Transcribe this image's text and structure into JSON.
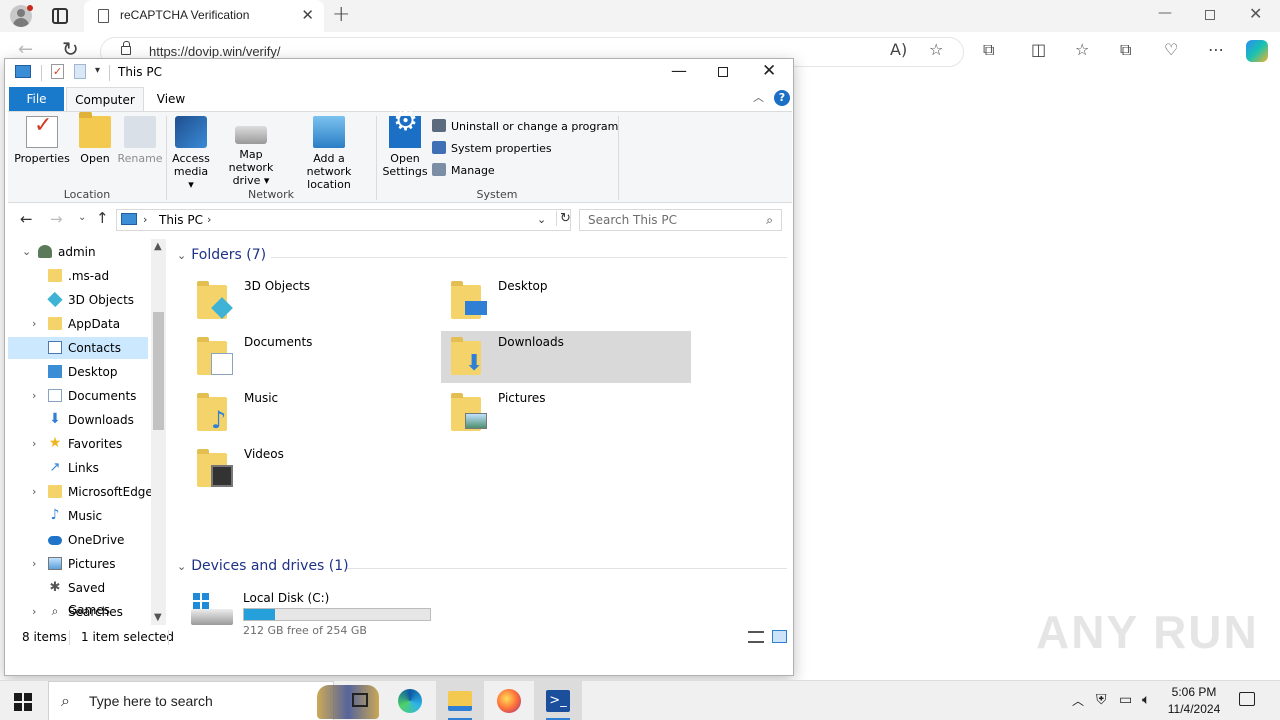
{
  "browser": {
    "tab_title": "reCAPTCHA Verification",
    "tab_close": "✕",
    "new_tab": "+",
    "url": "https://dovip.win/verify/",
    "min": "—",
    "close": "✕"
  },
  "explorer": {
    "title": "This PC",
    "min": "—",
    "close": "✕",
    "tabs": {
      "file": "File",
      "computer": "Computer",
      "view": "View"
    },
    "help": "?",
    "ribbon": {
      "location": {
        "label": "Location",
        "properties": "Properties",
        "open": "Open",
        "rename": "Rename"
      },
      "network": {
        "label": "Network",
        "access_media": [
          "Access",
          "media ▾"
        ],
        "map_drive": [
          "Map network",
          "drive ▾"
        ],
        "add_location": [
          "Add a network",
          "location"
        ]
      },
      "system": {
        "label": "System",
        "open_settings": [
          "Open",
          "Settings"
        ],
        "uninstall": "Uninstall or change a program",
        "system_properties": "System properties",
        "manage": "Manage"
      }
    },
    "address": {
      "path": "This PC",
      "search_placeholder": "Search This PC"
    },
    "tree": [
      {
        "label": "admin",
        "expander": "⌄",
        "icon": "user-icon"
      },
      {
        "label": ".ms-ad",
        "expander": "",
        "icon": "folder-icon"
      },
      {
        "label": "3D Objects",
        "expander": "",
        "icon": "3d-objects-icon"
      },
      {
        "label": "AppData",
        "expander": "›",
        "icon": "folder-icon"
      },
      {
        "label": "Contacts",
        "expander": "",
        "icon": "contacts-icon",
        "selected": true
      },
      {
        "label": "Desktop",
        "expander": "",
        "icon": "desktop-icon"
      },
      {
        "label": "Documents",
        "expander": "›",
        "icon": "documents-icon"
      },
      {
        "label": "Downloads",
        "expander": "",
        "icon": "downloads-icon"
      },
      {
        "label": "Favorites",
        "expander": "›",
        "icon": "star-icon"
      },
      {
        "label": "Links",
        "expander": "",
        "icon": "links-icon"
      },
      {
        "label": "MicrosoftEdge",
        "expander": "›",
        "icon": "folder-icon"
      },
      {
        "label": "Music",
        "expander": "",
        "icon": "music-icon"
      },
      {
        "label": "OneDrive",
        "expander": "",
        "icon": "onedrive-icon"
      },
      {
        "label": "Pictures",
        "expander": "›",
        "icon": "pictures-icon"
      },
      {
        "label": "Saved Games",
        "expander": "",
        "icon": "saved-games-icon"
      },
      {
        "label": "Searches",
        "expander": "›",
        "icon": "search-icon"
      }
    ],
    "folders_header": "Folders (7)",
    "folders": [
      {
        "name": "3D Objects",
        "icon": "3d-objects-folder-icon"
      },
      {
        "name": "Desktop",
        "icon": "desktop-folder-icon"
      },
      {
        "name": "Documents",
        "icon": "documents-folder-icon"
      },
      {
        "name": "Downloads",
        "icon": "downloads-folder-icon",
        "selected": true
      },
      {
        "name": "Music",
        "icon": "music-folder-icon"
      },
      {
        "name": "Pictures",
        "icon": "pictures-folder-icon"
      },
      {
        "name": "Videos",
        "icon": "videos-folder-icon"
      }
    ],
    "devices_header": "Devices and drives (1)",
    "drive": {
      "name": "Local Disk (C:)",
      "free_text": "212 GB free of 254 GB",
      "used_fraction": 0.165,
      "bar_color": "#26a0da"
    },
    "status": {
      "items": "8 items",
      "selected": "1 item selected"
    }
  },
  "watermark": "ANY RUN",
  "taskbar": {
    "search_placeholder": "Type here to search",
    "time": "5:06 PM",
    "date": "11/4/2024",
    "ps_glyph": ">_"
  }
}
